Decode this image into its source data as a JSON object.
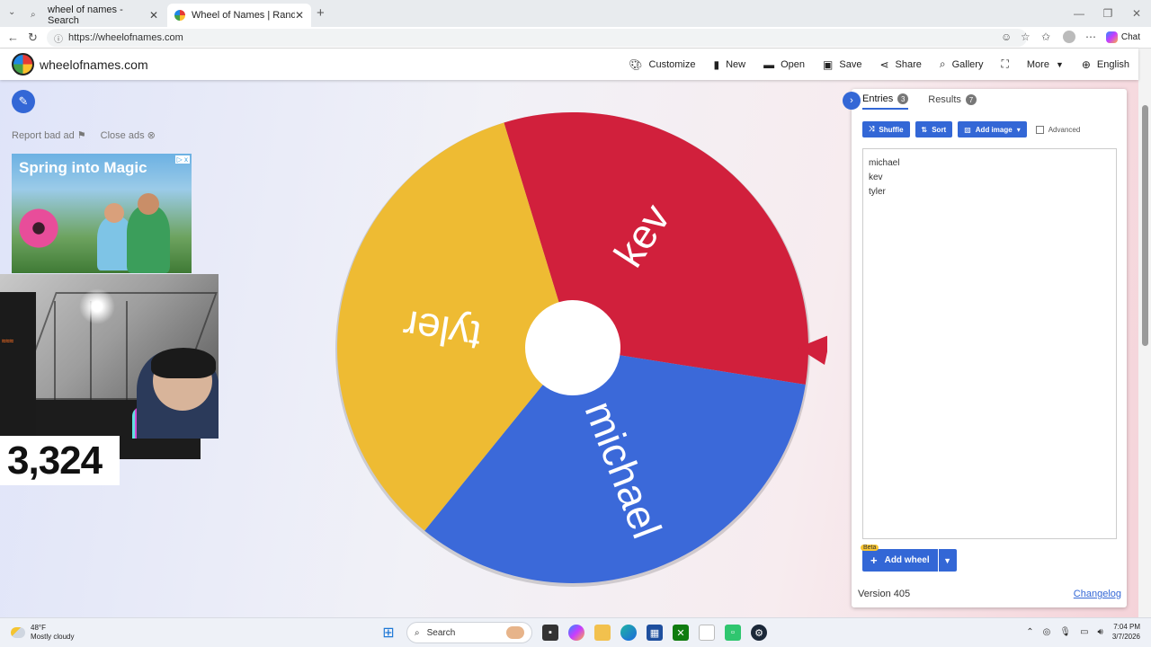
{
  "browser": {
    "tabs": [
      {
        "title": "wheel of names - Search"
      },
      {
        "title": "Wheel of Names | Random name"
      }
    ],
    "url": "https://wheelofnames.com",
    "copilot_label": "Chat"
  },
  "site": {
    "name": "wheelofnames.com",
    "menu": [
      {
        "label": "Customize",
        "icon": "palette-icon"
      },
      {
        "label": "New",
        "icon": "new-file-icon"
      },
      {
        "label": "Open",
        "icon": "folder-icon"
      },
      {
        "label": "Save",
        "icon": "floppy-icon"
      },
      {
        "label": "Share",
        "icon": "share-icon"
      },
      {
        "label": "Gallery",
        "icon": "search-icon"
      },
      {
        "label": "",
        "icon": "fullscreen-icon"
      },
      {
        "label": "More",
        "icon": "chevron-down-icon"
      },
      {
        "label": "English",
        "icon": "globe-icon"
      }
    ]
  },
  "ad": {
    "report_label": "Report bad ad",
    "close_label": "Close ads",
    "headline": "Spring into Magic",
    "badge": "▷ x"
  },
  "overlay": {
    "counter": "3,324"
  },
  "wheel": {
    "segments": [
      {
        "label": "kev",
        "color": "#d1203c"
      },
      {
        "label": "michael",
        "color": "#3b69d9"
      },
      {
        "label": "tyler",
        "color": "#eebb33"
      }
    ],
    "text_color": "#ffffff"
  },
  "panel": {
    "tabs": [
      {
        "label": "Entries",
        "count": "3"
      },
      {
        "label": "Results",
        "count": "7"
      }
    ],
    "buttons": {
      "shuffle": "Shuffle",
      "sort": "Sort",
      "add_image": "Add image"
    },
    "advanced_label": "Advanced",
    "entries": [
      "michael",
      "kev",
      "tyler"
    ],
    "beta_label": "Beta",
    "add_wheel_label": "Add wheel",
    "version": "Version 405",
    "changelog": "Changelog"
  },
  "taskbar": {
    "weather_temp": "48°F",
    "weather_desc": "Mostly cloudy",
    "search_label": "Search",
    "time": "7:04 PM",
    "date": "3/7/2026"
  },
  "colors": {
    "accent": "#3367d6"
  }
}
